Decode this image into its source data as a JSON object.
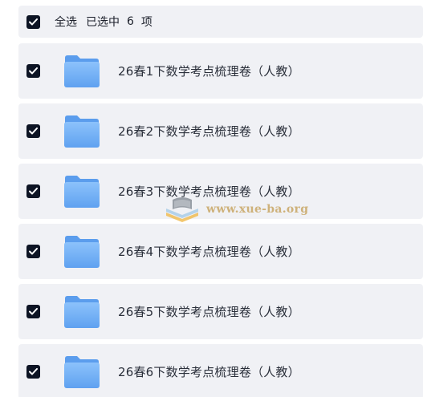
{
  "header": {
    "select_all_label": "全选",
    "selected_prefix": "已选中",
    "selected_count": "6",
    "selected_suffix": "项",
    "checked": true
  },
  "files": [
    {
      "name": "26春1下数学考点梳理卷（人教）",
      "checked": true,
      "icon": "folder-icon"
    },
    {
      "name": "26春2下数学考点梳理卷（人教）",
      "checked": true,
      "icon": "folder-icon"
    },
    {
      "name": "26春3下数学考点梳理卷（人教）",
      "checked": true,
      "icon": "folder-icon"
    },
    {
      "name": "26春4下数学考点梳理卷（人教）",
      "checked": true,
      "icon": "folder-icon"
    },
    {
      "name": "26春5下数学考点梳理卷（人教）",
      "checked": true,
      "icon": "folder-icon"
    },
    {
      "name": "26春6下数学考点梳理卷（人教）",
      "checked": true,
      "icon": "folder-icon"
    }
  ],
  "watermark": {
    "text": "www.xue-ba.org"
  },
  "colors": {
    "row_background": "#f0f1f5",
    "checkbox_fill": "#0d1424",
    "folder_blue": "#6aaaf5",
    "watermark_gold": "#c9a765"
  }
}
